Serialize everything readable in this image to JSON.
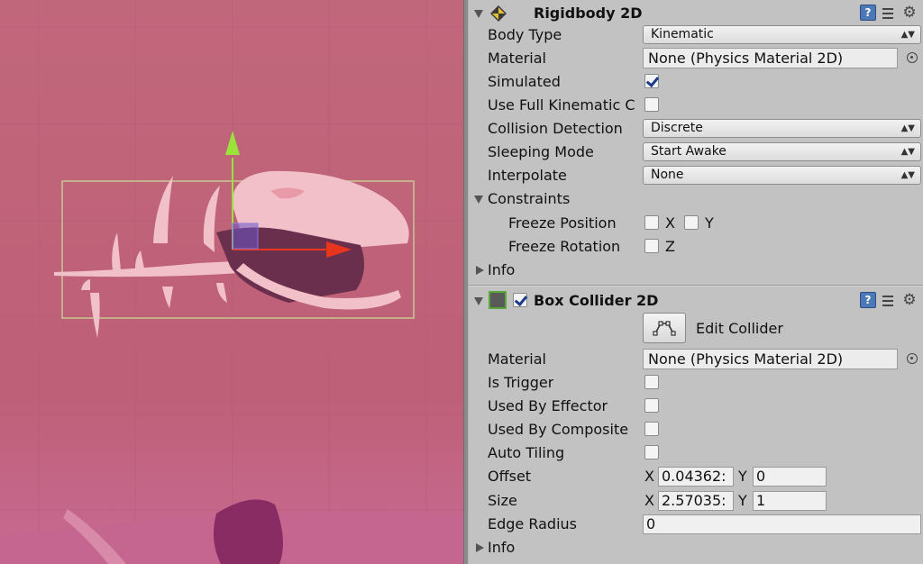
{
  "colors": {
    "scene_bg": "#c1677b",
    "bone": "#f2c0c8",
    "bone_shadow": "#6a2f4c",
    "gizmo_y": "#9be23a",
    "gizmo_x": "#e8361e",
    "gizmo_box": "#6a55c8",
    "collider": "#c8c890",
    "panel_bg": "#c2c2c2"
  },
  "rigidbody": {
    "title": "Rigidbody 2D",
    "icon": "rigidbody-icon",
    "body_type": {
      "label": "Body Type",
      "value": "Kinematic"
    },
    "material": {
      "label": "Material",
      "value": "None (Physics Material 2D)"
    },
    "simulated": {
      "label": "Simulated",
      "checked": true
    },
    "use_full_kinematic": {
      "label": "Use Full Kinematic C",
      "checked": false
    },
    "collision_detection": {
      "label": "Collision Detection",
      "value": "Discrete"
    },
    "sleeping_mode": {
      "label": "Sleeping Mode",
      "value": "Start Awake"
    },
    "interpolate": {
      "label": "Interpolate",
      "value": "None"
    },
    "constraints": {
      "label": "Constraints",
      "freeze_position": {
        "label": "Freeze Position",
        "x": "X",
        "y": "Y"
      },
      "freeze_rotation": {
        "label": "Freeze Rotation",
        "z": "Z"
      }
    },
    "info_label": "Info"
  },
  "box_collider": {
    "title": "Box Collider 2D",
    "enabled": true,
    "edit_collider_label": "Edit Collider",
    "material": {
      "label": "Material",
      "value": "None (Physics Material 2D)"
    },
    "is_trigger": {
      "label": "Is Trigger",
      "checked": false
    },
    "used_by_effector": {
      "label": "Used By Effector",
      "checked": false
    },
    "used_by_composite": {
      "label": "Used By Composite",
      "checked": false
    },
    "auto_tiling": {
      "label": "Auto Tiling",
      "checked": false
    },
    "offset": {
      "label": "Offset",
      "x_label": "X",
      "x": "0.04362:",
      "y_label": "Y",
      "y": "0"
    },
    "size": {
      "label": "Size",
      "x_label": "X",
      "x": "2.57035:",
      "y_label": "Y",
      "y": "1"
    },
    "edge_radius": {
      "label": "Edge Radius",
      "value": "0"
    },
    "info_label": "Info"
  },
  "header_icons": {
    "help": "?"
  }
}
